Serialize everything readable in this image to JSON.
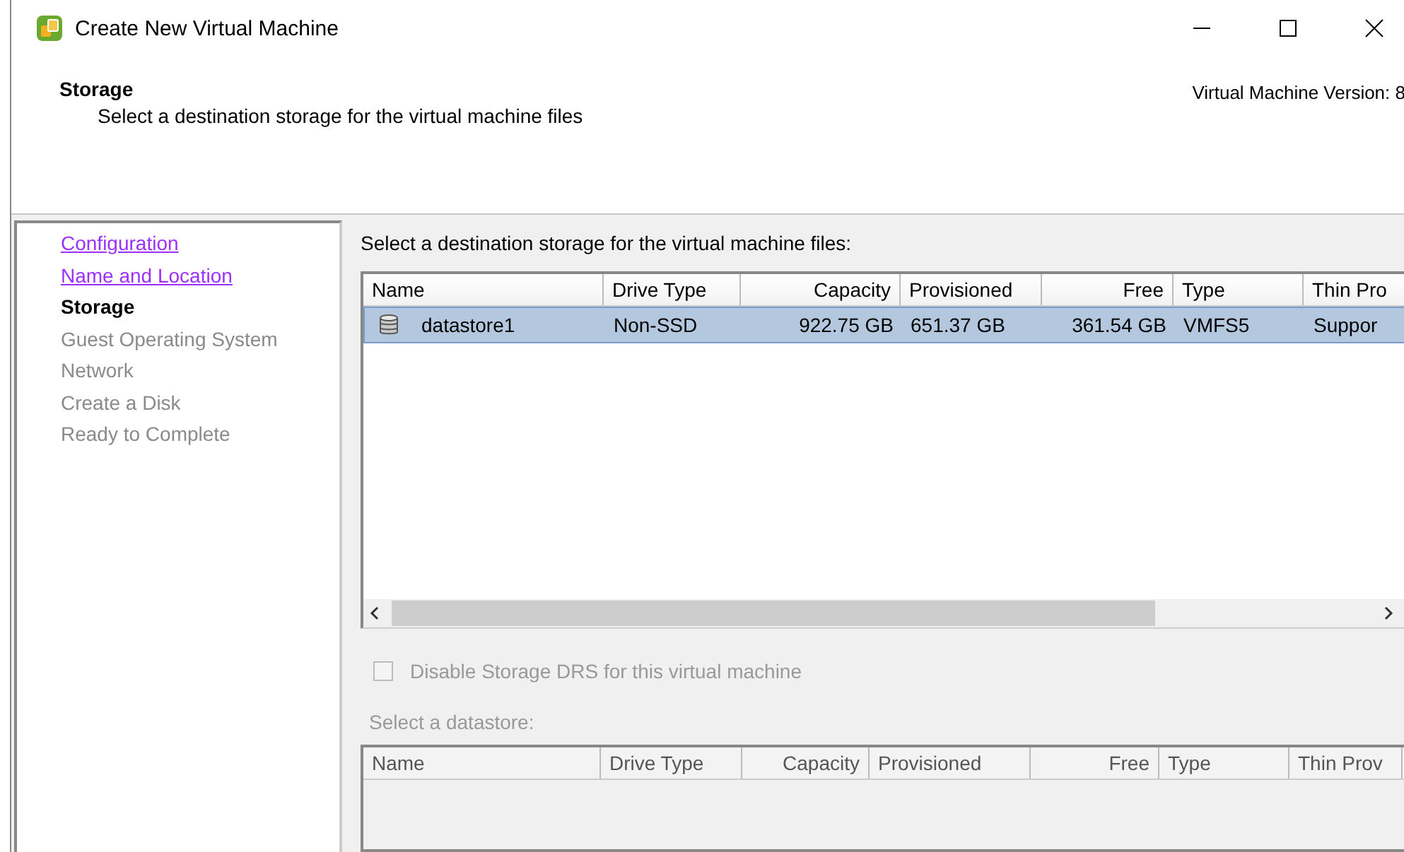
{
  "window": {
    "title": "Create New Virtual Machine"
  },
  "header": {
    "title": "Storage",
    "subtitle": "Select a destination storage for the virtual machine files",
    "version": "Virtual Machine Version: 8"
  },
  "steps": [
    {
      "label": "Configuration",
      "kind": "visited"
    },
    {
      "label": "Name and Location",
      "kind": "visited"
    },
    {
      "label": "Storage",
      "kind": "current"
    },
    {
      "label": "Guest Operating System",
      "kind": "pending"
    },
    {
      "label": "Network",
      "kind": "pending"
    },
    {
      "label": "Create a Disk",
      "kind": "pending"
    },
    {
      "label": "Ready to Complete",
      "kind": "pending"
    }
  ],
  "prompt": "Select a destination storage for the virtual machine files:",
  "storage_table": {
    "columns": [
      {
        "label": "Name",
        "kind": "text"
      },
      {
        "label": "Drive Type",
        "kind": "text"
      },
      {
        "label": "Capacity",
        "kind": "number"
      },
      {
        "label": "Provisioned",
        "kind": "text"
      },
      {
        "label": "Free",
        "kind": "number"
      },
      {
        "label": "Type",
        "kind": "text"
      },
      {
        "label": "Thin Pro",
        "kind": "text"
      }
    ],
    "rows": [
      {
        "selected": true,
        "cells": [
          "datastore1",
          "Non-SSD",
          "922.75 GB",
          "651.37 GB",
          "361.54 GB",
          "VMFS5",
          "Suppor"
        ]
      }
    ]
  },
  "drs_checkbox": {
    "label": "Disable Storage DRS for this virtual machine",
    "checked": false,
    "disabled": true
  },
  "datastore_label": "Select a datastore:",
  "datastore_table": {
    "columns": [
      {
        "label": "Name",
        "kind": "text"
      },
      {
        "label": "Drive Type",
        "kind": "text"
      },
      {
        "label": "Capacity",
        "kind": "number"
      },
      {
        "label": "Provisioned",
        "kind": "text"
      },
      {
        "label": "Free",
        "kind": "number"
      },
      {
        "label": "Type",
        "kind": "text"
      },
      {
        "label": "Thin Prov",
        "kind": "text"
      }
    ]
  }
}
